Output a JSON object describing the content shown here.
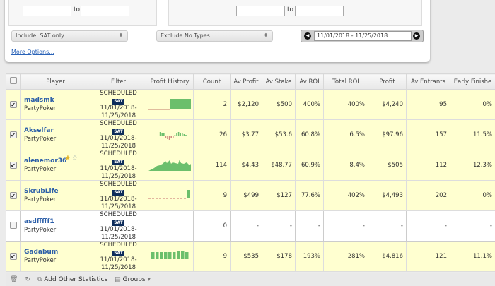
{
  "filters": {
    "to_label": "to",
    "include": "Include: SAT only",
    "exclude": "Exclude No Types",
    "date_range": "11/01/2018 - 11/25/2018",
    "more_options": "More Options..."
  },
  "columns": [
    "Player",
    "Filter",
    "Profit History",
    "Count",
    "Av Profit",
    "Av Stake",
    "Av ROI",
    "Total ROI",
    "Profit",
    "Av Entrants",
    "Early Finishe"
  ],
  "rows": [
    {
      "name": "madsmk",
      "site": "PartyPoker",
      "checked": true,
      "filter": {
        "type": "SCHEDULED",
        "badge": "SAT",
        "from": "11/01/2018-",
        "to": "11/25/2018"
      },
      "count": "2",
      "av_profit": "$2,120",
      "av_stake": "$500",
      "av_roi": "400%",
      "total_roi": "400%",
      "profit": "$4,240",
      "av_entrants": "95",
      "early": "0%"
    },
    {
      "name": "Akselfar",
      "site": "PartyPoker",
      "checked": true,
      "filter": {
        "type": "SCHEDULED",
        "badge": "SAT",
        "from": "11/01/2018-",
        "to": "11/25/2018"
      },
      "count": "26",
      "av_profit": "$3.77",
      "av_stake": "$53.6",
      "av_roi": "60.8%",
      "total_roi": "6.5%",
      "profit": "$97.96",
      "av_entrants": "157",
      "early": "11.5%"
    },
    {
      "name": "alenemor36",
      "site": "PartyPoker",
      "checked": true,
      "filter": {
        "type": "SCHEDULED",
        "badge": "SAT",
        "from": "11/01/2018-",
        "to": "11/25/2018"
      },
      "count": "114",
      "av_profit": "$4.43",
      "av_stake": "$48.77",
      "av_roi": "60.9%",
      "total_roi": "8.4%",
      "profit": "$505",
      "av_entrants": "112",
      "early": "12.3%"
    },
    {
      "name": "SkrubLife",
      "site": "PartyPoker",
      "checked": true,
      "filter": {
        "type": "SCHEDULED",
        "badge": "SAT",
        "from": "11/01/2018-",
        "to": "11/25/2018"
      },
      "count": "9",
      "av_profit": "$499",
      "av_stake": "$127",
      "av_roi": "77.6%",
      "total_roi": "402%",
      "profit": "$4,493",
      "av_entrants": "202",
      "early": "0%"
    },
    {
      "name": "asdfffff1",
      "site": "PartyPoker",
      "checked": false,
      "filter": {
        "type": "SCHEDULED",
        "badge": "SAT",
        "from": "11/01/2018-",
        "to": "11/25/2018"
      },
      "count": "0",
      "av_profit": "-",
      "av_stake": "-",
      "av_roi": "-",
      "total_roi": "-",
      "profit": "-",
      "av_entrants": "-",
      "early": "-"
    },
    {
      "name": "Gadabum",
      "site": "PartyPoker",
      "checked": true,
      "filter": {
        "type": "SCHEDULED",
        "badge": "SAT",
        "from": "11/01/2018-",
        "to": "11/25/2018"
      },
      "count": "9",
      "av_profit": "$535",
      "av_stake": "$178",
      "av_roi": "193%",
      "total_roi": "281%",
      "profit": "$4,816",
      "av_entrants": "121",
      "early": "11.1%"
    }
  ],
  "footer": {
    "add_stats": "Add Other Statistics",
    "groups": "Groups"
  }
}
